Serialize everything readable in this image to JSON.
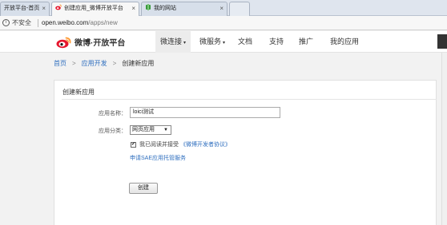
{
  "browser": {
    "tabs": [
      {
        "title": "开放平台-首页"
      },
      {
        "title": "创建应用_微博开放平台"
      },
      {
        "title": "我的网站"
      }
    ],
    "close_glyph": "×",
    "security_label": "不安全",
    "url_host": "open.weibo.com",
    "url_path": "/apps/new"
  },
  "site": {
    "logo_text": "微博·开放平台",
    "nav": [
      {
        "label": "微连接"
      },
      {
        "label": "微服务"
      },
      {
        "label": "文档"
      },
      {
        "label": "支持"
      },
      {
        "label": "推广"
      },
      {
        "label": "我的应用"
      }
    ],
    "caret_glyph": "▾"
  },
  "breadcrumb": {
    "items": [
      "首页",
      "应用开发",
      "创建新应用"
    ],
    "separator": ">"
  },
  "form": {
    "title": "创建新应用",
    "name_label": "应用名称：",
    "name_value": "loici测试",
    "category_label": "应用分类：",
    "category_value": "网页应用",
    "select_arrow": "▼",
    "agree_checked": true,
    "agree_check_glyph": "✔",
    "agree_text": "我已阅读并接受",
    "agree_link": "《微博开发者协议》",
    "sae_link": "申请SAE应用托管服务",
    "create_button": "创建"
  },
  "colors": {
    "link": "#2f6fbf",
    "weibo_red": "#e6162d",
    "weibo_orange": "#ff9933"
  }
}
